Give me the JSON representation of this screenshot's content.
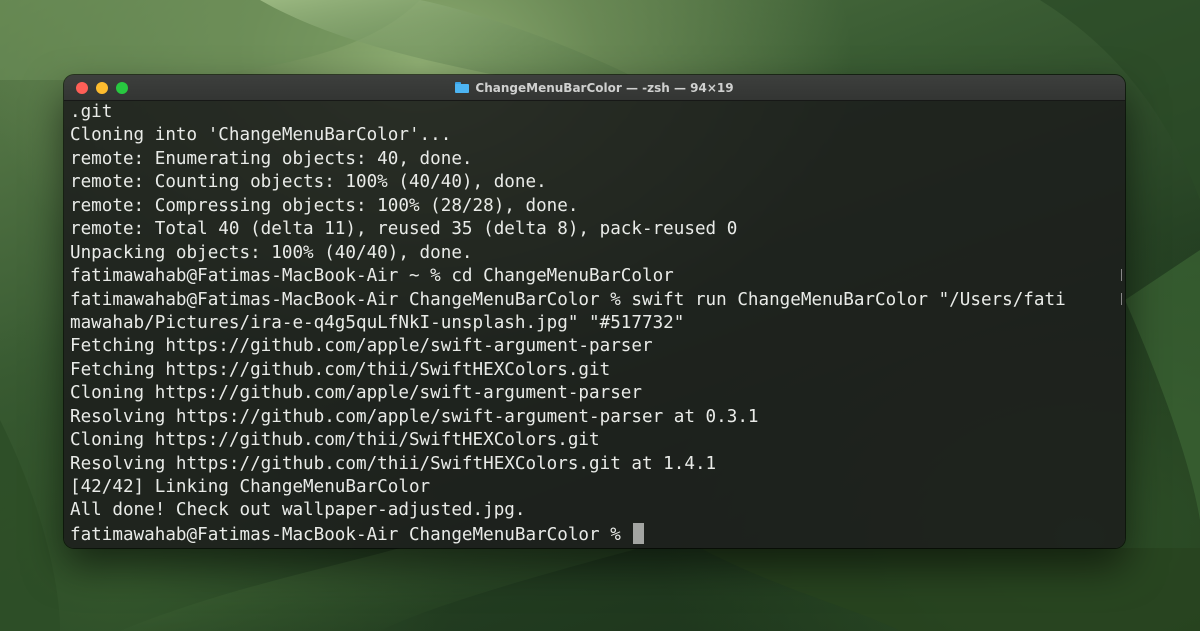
{
  "window": {
    "title": "ChangeMenuBarColor — -zsh — 94×19",
    "title_icon": "folder-icon"
  },
  "terminal": {
    "lines": [
      ".git",
      "Cloning into 'ChangeMenuBarColor'...",
      "remote: Enumerating objects: 40, done.",
      "remote: Counting objects: 100% (40/40), done.",
      "remote: Compressing objects: 100% (28/28), done.",
      "remote: Total 40 (delta 11), reused 35 (delta 8), pack-reused 0",
      "Unpacking objects: 100% (40/40), done.",
      "fatimawahab@Fatimas-MacBook-Air ~ % cd ChangeMenuBarColor",
      "fatimawahab@Fatimas-MacBook-Air ChangeMenuBarColor % swift run ChangeMenuBarColor \"/Users/fati",
      "mawahab/Pictures/ira-e-q4g5quLfNkI-unsplash.jpg\" \"#517732\"",
      "Fetching https://github.com/apple/swift-argument-parser",
      "Fetching https://github.com/thii/SwiftHEXColors.git",
      "Cloning https://github.com/apple/swift-argument-parser",
      "Resolving https://github.com/apple/swift-argument-parser at 0.3.1",
      "Cloning https://github.com/thii/SwiftHEXColors.git",
      "Resolving https://github.com/thii/SwiftHEXColors.git at 1.4.1",
      "[42/42] Linking ChangeMenuBarColor",
      "All done! Check out wallpaper-adjusted.jpg."
    ],
    "prompt": "fatimawahab@Fatimas-MacBook-Air ChangeMenuBarColor % "
  },
  "colors": {
    "close": "#ff5f57",
    "minimize": "#febc2e",
    "maximize": "#28c840",
    "text": "#e9ebe8",
    "cursor": "#a3a5a2"
  }
}
